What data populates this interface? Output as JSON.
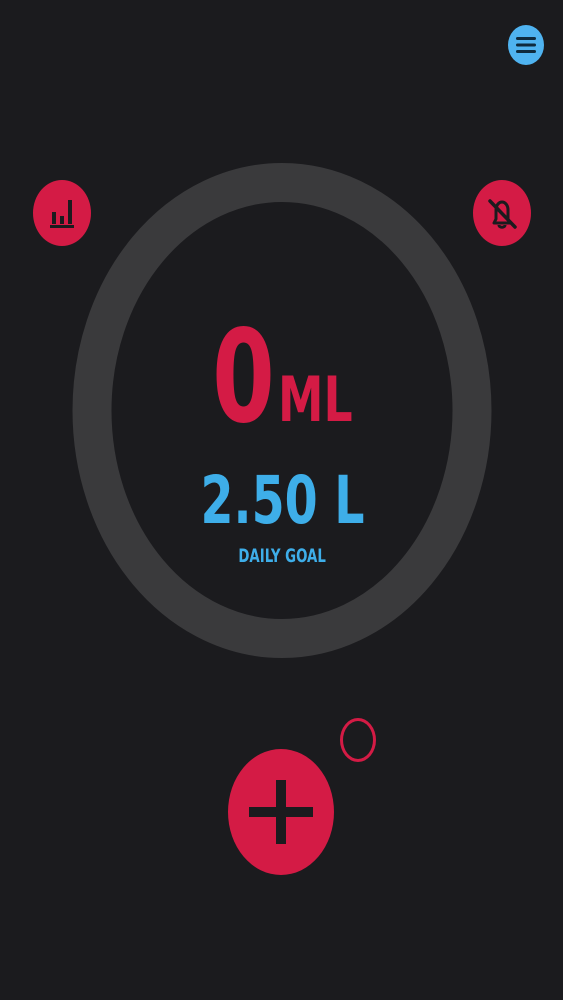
{
  "intake": {
    "value": "0",
    "unit": "ML"
  },
  "goal": {
    "value": "2.50 L",
    "label": "DAILY GOAL"
  },
  "icons": {
    "menu": "menu-icon",
    "stats": "bar-chart-icon",
    "mute": "bell-off-icon",
    "add": "plus-icon",
    "indicator": "ring-indicator"
  },
  "colors": {
    "background": "#1b1b1e",
    "ring": "#3a3a3c",
    "accent_red": "#d41b45",
    "accent_blue": "#3eaee9"
  },
  "progress": {
    "fraction": 0
  }
}
